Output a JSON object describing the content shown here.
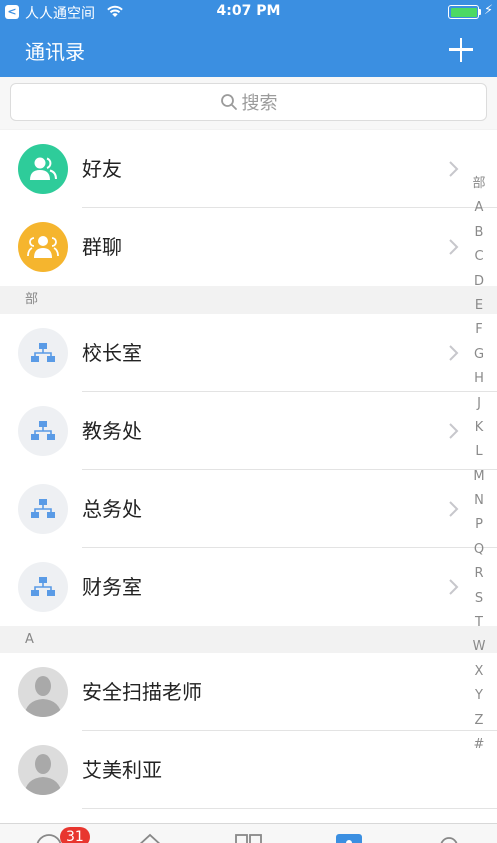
{
  "status_bar": {
    "back_glyph": "<",
    "carrier": "人人通空间",
    "time": "4:07 PM"
  },
  "nav": {
    "title": "通讯录",
    "add_icon": "plus-icon"
  },
  "search": {
    "placeholder": "搜索"
  },
  "top_items": [
    {
      "label": "好友",
      "icon": "friends-icon",
      "color": "#2ecc9a"
    },
    {
      "label": "群聊",
      "icon": "group-chat-icon",
      "color": "#f5b52e"
    }
  ],
  "sections": [
    {
      "header": "部",
      "items": [
        {
          "label": "校长室",
          "icon": "org-chart-icon"
        },
        {
          "label": "教务处",
          "icon": "org-chart-icon"
        },
        {
          "label": "总务处",
          "icon": "org-chart-icon"
        },
        {
          "label": "财务室",
          "icon": "org-chart-icon"
        }
      ]
    },
    {
      "header": "A",
      "items": [
        {
          "label": "安全扫描老师",
          "icon": "person-avatar-icon"
        },
        {
          "label": "艾美利亚",
          "icon": "person-avatar-icon"
        }
      ]
    }
  ],
  "index_letters": [
    "部",
    "A",
    "B",
    "C",
    "D",
    "E",
    "F",
    "G",
    "H",
    "J",
    "K",
    "L",
    "M",
    "N",
    "P",
    "Q",
    "R",
    "S",
    "T",
    "W",
    "X",
    "Y",
    "Z",
    "#"
  ],
  "tabbar": {
    "badge": "31"
  },
  "colors": {
    "accent": "#3b8fe1",
    "friends": "#2ecc9a",
    "groups": "#f5b52e",
    "org_icon": "#5a9be6",
    "badge": "#e8362f"
  }
}
